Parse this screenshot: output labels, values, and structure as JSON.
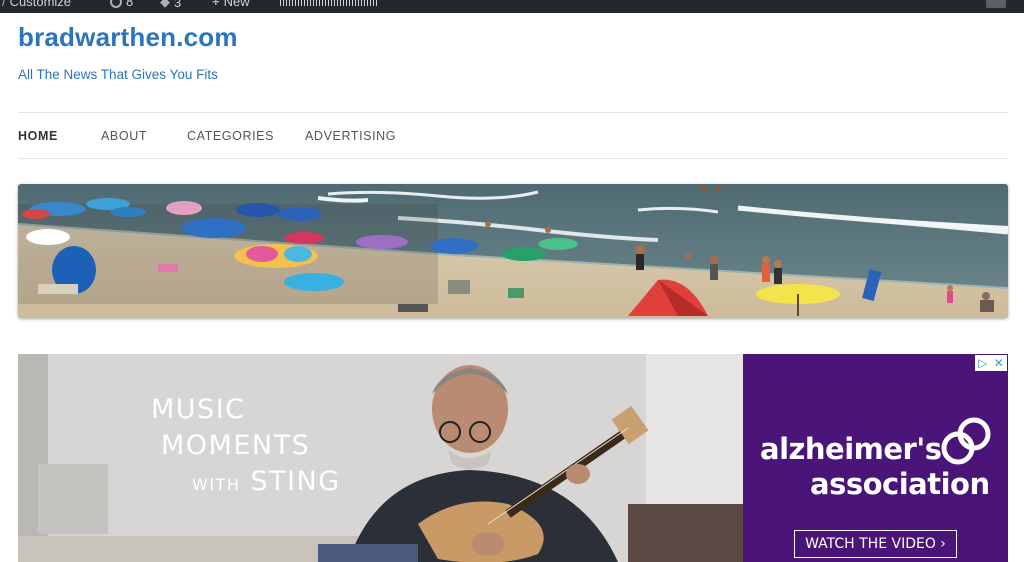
{
  "admin_bar": {
    "customize_label": "Customize",
    "updates_count": "8",
    "comments_count": "3",
    "new_label": "New"
  },
  "site": {
    "title": "bradwarthen.com",
    "tagline": "All The News That Gives You Fits"
  },
  "nav": {
    "items": [
      {
        "label": "HOME",
        "active": true
      },
      {
        "label": "ABOUT"
      },
      {
        "label": "CATEGORIES"
      },
      {
        "label": "ADVERTISING"
      }
    ]
  },
  "ad": {
    "headline_line1": "MUSIC",
    "headline_line2": "MOMENTS",
    "headline_with": "WITH",
    "headline_sting": "STING",
    "brand_line1": "alzheimer's",
    "brand_line2": "association",
    "cta_label": "WATCH THE VIDEO ›",
    "adchoices_icons": [
      "adchoices-triangle-icon",
      "close-icon"
    ],
    "colors": {
      "brand_purple": "#4a1478",
      "link_blue": "#2a75be",
      "adbar": "#23282d"
    }
  }
}
